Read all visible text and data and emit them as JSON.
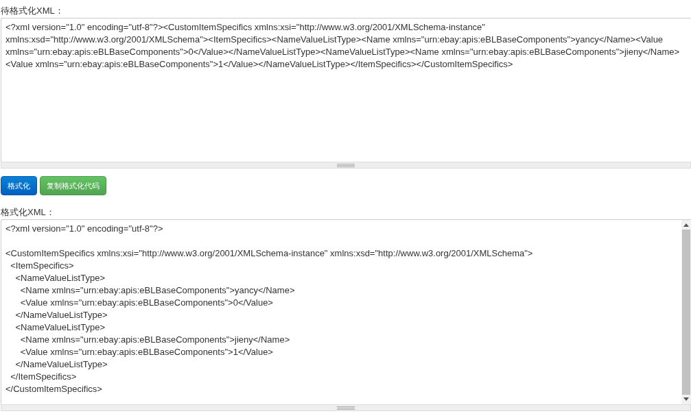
{
  "input_label": "待格式化XML：",
  "input": {
    "value": "<?xml version=\"1.0\" encoding=\"utf-8\"?><CustomItemSpecifics xmlns:xsi=\"http://www.w3.org/2001/XMLSchema-instance\" xmlns:xsd=\"http://www.w3.org/2001/XMLSchema\"><ItemSpecifics><NameValueListType><Name xmlns=\"urn:ebay:apis:eBLBaseComponents\">yancy</Name><Value xmlns=\"urn:ebay:apis:eBLBaseComponents\">0</Value></NameValueListType><NameValueListType><Name xmlns=\"urn:ebay:apis:eBLBaseComponents\">jieny</Name><Value xmlns=\"urn:ebay:apis:eBLBaseComponents\">1</Value></NameValueListType></ItemSpecifics></CustomItemSpecifics>"
  },
  "buttons": [
    {
      "label": "格式化",
      "kind": "primary"
    },
    {
      "label": "复制格式化代码",
      "kind": "success"
    }
  ],
  "output_label": "格式化XML：",
  "output": {
    "value": "<?xml version=\"1.0\" encoding=\"utf-8\"?>\n\n<CustomItemSpecifics xmlns:xsi=\"http://www.w3.org/2001/XMLSchema-instance\" xmlns:xsd=\"http://www.w3.org/2001/XMLSchema\">\n  <ItemSpecifics>\n    <NameValueListType>\n      <Name xmlns=\"urn:ebay:apis:eBLBaseComponents\">yancy</Name>\n      <Value xmlns=\"urn:ebay:apis:eBLBaseComponents\">0</Value>\n    </NameValueListType>\n    <NameValueListType>\n      <Name xmlns=\"urn:ebay:apis:eBLBaseComponents\">jieny</Name>\n      <Value xmlns=\"urn:ebay:apis:eBLBaseComponents\">1</Value>\n    </NameValueListType>\n  </ItemSpecifics>\n</CustomItemSpecifics>"
  }
}
